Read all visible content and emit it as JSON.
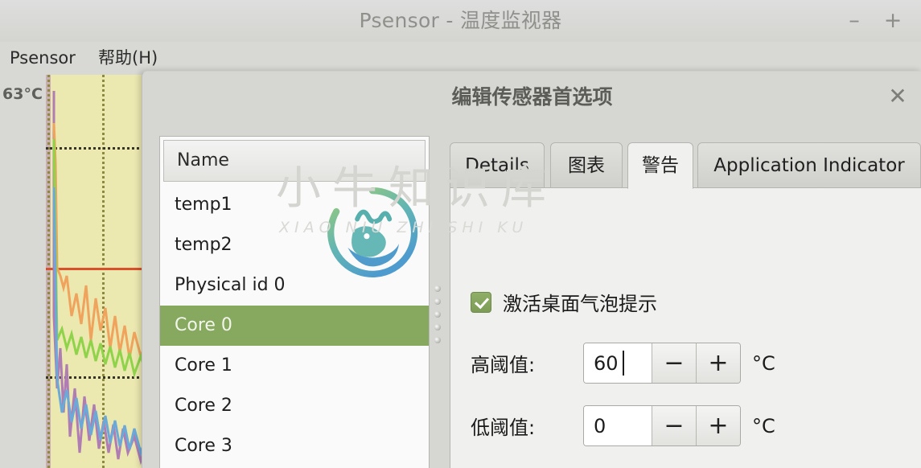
{
  "window": {
    "title": "Psensor - 温度监视器",
    "minimize_label": "–",
    "maximize_label": "+"
  },
  "menubar": {
    "items": [
      {
        "label": "Psensor"
      },
      {
        "label": "帮助(H)"
      }
    ]
  },
  "graph": {
    "top_temperature_label": "63°C"
  },
  "dialog": {
    "title": "编辑传感器首选项",
    "close_label": "✕"
  },
  "sensor_list": {
    "column_header": "Name",
    "rows": [
      {
        "label": "temp1",
        "selected": false
      },
      {
        "label": "temp2",
        "selected": false
      },
      {
        "label": "Physical id 0",
        "selected": false
      },
      {
        "label": "Core 0",
        "selected": true
      },
      {
        "label": "Core 1",
        "selected": false
      },
      {
        "label": "Core 2",
        "selected": false
      },
      {
        "label": "Core 3",
        "selected": false
      }
    ],
    "selected_row_color": "#86a85f"
  },
  "tabs": [
    {
      "label": "Details",
      "active": false
    },
    {
      "label": "图表",
      "active": false
    },
    {
      "label": "警告",
      "active": true
    },
    {
      "label": "Application Indicator",
      "active": false
    }
  ],
  "alarm_panel": {
    "desktop_notification": {
      "label": "激活桌面气泡提示",
      "checked": true
    },
    "high_threshold": {
      "label": "高阈值:",
      "value": "60",
      "decrement_label": "−",
      "increment_label": "+",
      "unit": "°C"
    },
    "low_threshold": {
      "label": "低阈值:",
      "value": "0",
      "decrement_label": "−",
      "increment_label": "+",
      "unit": "°C"
    }
  },
  "watermark": {
    "chinese": "小牛知识库",
    "pinyin": "XIAO NIU ZHI SHI KU"
  },
  "chart_data": {
    "type": "line",
    "title": "",
    "xlabel": "",
    "ylabel": "",
    "ylim": [
      0,
      63
    ],
    "top_tick_label": "63°C",
    "grid": true,
    "plot_background": "#ebe8b0",
    "threshold_line_color": "#d9502a",
    "series": [
      {
        "name": "orange-sensor",
        "color": "#f0a35c"
      },
      {
        "name": "green-sensor",
        "color": "#8fd34a"
      },
      {
        "name": "purple-sensor",
        "color": "#b07cb4"
      },
      {
        "name": "blue-sensor",
        "color": "#6aa9d8"
      }
    ]
  }
}
